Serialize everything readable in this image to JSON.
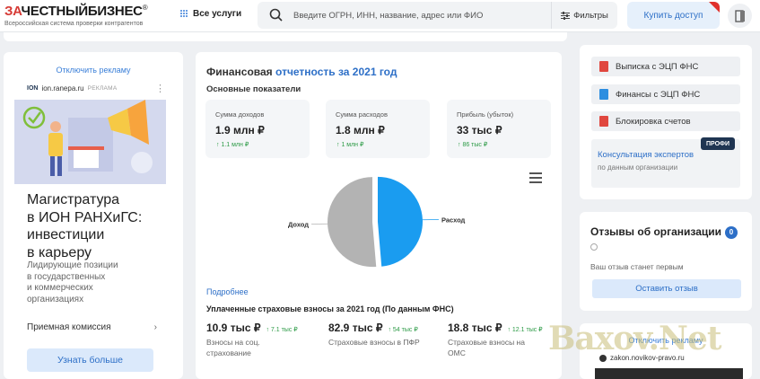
{
  "header": {
    "logo_za": "ЗА",
    "logo_rest": "ЧЕСТНЫЙБИЗНЕС",
    "logo_reg": "®",
    "logo_sub": "Всероссийская система проверки контрагентов",
    "services_label": "Все услуги",
    "search_placeholder": "Введите ОГРН, ИНН, название, адрес или ФИО",
    "filters_label": "Фильтры",
    "buy_label": "Купить доступ"
  },
  "ad_left": {
    "disable_label": "Отключить рекламу",
    "source": "ion.ranepa.ru",
    "source_tag": "РЕКЛАМА",
    "title_lines": [
      "Магистратура",
      "в ИОН РАНХиГС:",
      "инвестиции",
      "в карьеру"
    ],
    "text_lines": [
      "Лидирующие позиции",
      "в государственных",
      "и коммерческих",
      "организациях"
    ],
    "admission_label": "Приемная комиссия",
    "cta_label": "Узнать больше"
  },
  "finance": {
    "title_prefix": "Финансовая",
    "title_link": "отчетность за 2021 год",
    "main_indicators": "Основные показатели",
    "metrics": [
      {
        "label": "Сумма доходов",
        "value": "1.9 млн ₽",
        "delta": "↑ 1.1 млн ₽"
      },
      {
        "label": "Сумма расходов",
        "value": "1.8 млн ₽",
        "delta": "↑ 1 млн ₽"
      },
      {
        "label": "Прибыль (убыток)",
        "value": "33 тыс ₽",
        "delta": "↑ 86 тыс ₽"
      }
    ],
    "more_label": "Подробнее",
    "insurance_title": "Уплаченные страховые взносы за 2021 год (По данным ФНС)",
    "insurance": [
      {
        "value": "10.9 тыс ₽",
        "delta": "↑ 7.1 тыс ₽",
        "label_lines": [
          "Взносы на соц.",
          "страхование"
        ]
      },
      {
        "value": "82.9 тыс ₽",
        "delta": "↑ 54 тыс ₽",
        "label_lines": [
          "Страховые взносы в ПФР"
        ]
      },
      {
        "value": "18.8 тыс ₽",
        "delta": "↑ 12.1 тыс ₽",
        "label_lines": [
          "Страховые взносы на",
          "ОМС"
        ]
      }
    ]
  },
  "chart_data": {
    "type": "pie",
    "categories": [
      "Доход",
      "Расход"
    ],
    "values": [
      1.9,
      1.8
    ],
    "unit": "млн ₽",
    "colors": [
      "#b3b3b3",
      "#1a9cf0"
    ]
  },
  "sidebar": {
    "buttons": [
      {
        "label": "Выписка с ЭЦП ФНС",
        "icon": "pdf-icon",
        "color": "#e0473f"
      },
      {
        "label": "Финансы с ЭЦП ФНС",
        "icon": "doc-icon",
        "color": "#2d8ee0"
      },
      {
        "label": "Блокировка счетов",
        "icon": "lock-doc-icon",
        "color": "#e0473f"
      }
    ],
    "consult_title": "Консультация экспертов",
    "consult_sub": "по данным организации",
    "pro_badge": "ПРОФИ"
  },
  "reviews": {
    "title": "Отзывы об организации",
    "count": "0",
    "empty_text": "Ваш отзыв станет первым",
    "leave_label": "Оставить отзыв"
  },
  "ad_right": {
    "disable_label": "Отключить рекламу",
    "source": "zakon.novikov-pravo.ru"
  },
  "watermark": "Baxov.Net"
}
